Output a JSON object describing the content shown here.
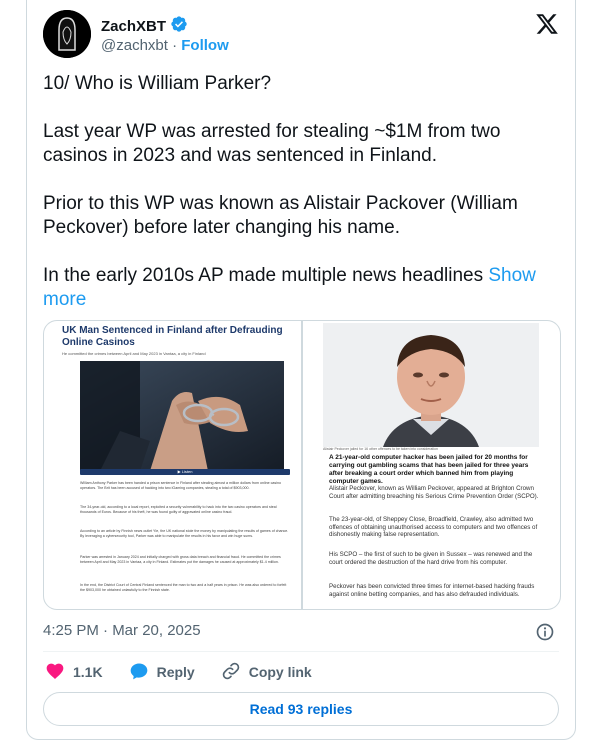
{
  "author": {
    "name": "ZachXBT",
    "handle": "@zachxbt",
    "separator": "·",
    "follow_label": "Follow"
  },
  "tweet": {
    "paragraphs": [
      "10/ Who is William Parker?",
      "Last year WP was arrested for stealing ~$1M from two casinos in 2023 and was sentenced in Finland.",
      "Prior to this WP was known as Alistair Packover (William Peckover) before later changing his name.",
      "In the early 2010s AP made multiple news headlines"
    ],
    "show_more_label": "Show more"
  },
  "media": {
    "left": {
      "title": "UK Man Sentenced in Finland after Defrauding Online Casinos",
      "subtitle": "He committed the crimes between April and May 2023 in Vantaa, a city in Finland",
      "image_caption": "Image Source: Shutterstock.com",
      "listen_label": "▶ Listen",
      "paragraphs": [
        "William Anthony Parker has been handed a prison sentence in Finland after stealing almost a million dollars from online casino operators. The Brit has been accused of hacking into two iGaming companies, stealing a total of $903,000.",
        "The 34-year-old, according to a local report, exploited a security vulnerability to hack into the two casino operators and steal thousands of Euros. Because of his theft, he was found guilty of aggravated online casino fraud.",
        "According to an article by Finnish news outlet Yle, the UK national stole the money by manipulating the results of games of chance. By leveraging a cybersecurity tool, Parker was able to manipulate the results in his favor and win huge sums.",
        "Parker was arrested in January 2024 and initially charged with gross data breach and financial fraud. He committed the crimes between April and May 2023 in Vantaa, a city in Finland. Estimates put the damages he caused at approximately $1.4 million.",
        "In the end, the District Court of Central Finland sentenced the man to two and a half years in prison. He was also ordered to forfeit the $903,000 he obtained unlawfully to the Finnish state."
      ]
    },
    "right": {
      "photo_caption": "Alistair Peckover jailed for 16 other offences to be taken into consideration",
      "headline": "A 21-year-old computer hacker has been jailed for 20 months for carrying out gambling scams that has been jailed for three years after breaking a court order which banned him from playing computer games.",
      "paragraphs": [
        "Alistair Peckover, known as William Peckover, appeared at Brighton Crown Court after admitting breaching his Serious Crime Prevention Order (SCPO).",
        "The 23-year-old, of Sheppey Close, Broadfield, Crawley, also admitted two offences of obtaining unauthorised access to computers and two offences of dishonestly making false representation.",
        "His SCPO – the first of such to be given in Sussex – was renewed and the court ordered the destruction of the hard drive from his computer.",
        "Peckover has been convicted three times for internet-based hacking frauds against online betting companies, and has also defrauded individuals."
      ]
    }
  },
  "timestamp": "4:25 PM · Mar 20, 2025",
  "actions": {
    "likes": "1.1K",
    "reply_label": "Reply",
    "copy_link_label": "Copy link"
  },
  "read_replies_label": "Read 93 replies",
  "colors": {
    "accent": "#1d9bf0",
    "like": "#f91880",
    "text": "#0f1419",
    "muted": "#536471",
    "border": "#cfd9de"
  },
  "icons": [
    "verified-badge-icon",
    "x-logo-icon",
    "info-icon",
    "heart-icon",
    "reply-icon",
    "link-icon"
  ]
}
